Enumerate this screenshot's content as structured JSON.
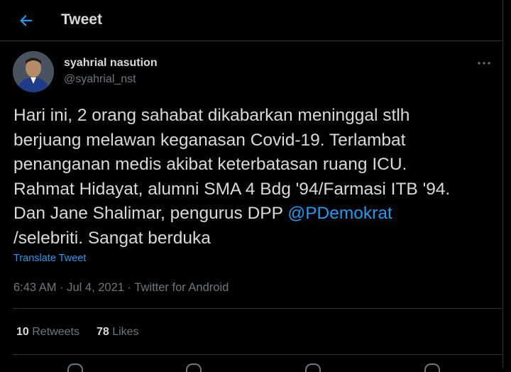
{
  "header": {
    "title": "Tweet"
  },
  "author": {
    "name": "syahrial nasution",
    "handle": "@syahrial_nst"
  },
  "tweet": {
    "lines": [
      "Hari ini, 2 orang sahabat dikabarkan meninggal stlh",
      "berjuang melawan keganasan Covid-19. Terlambat",
      "penanganan medis akibat keterbatasan ruang ICU.",
      "Rahmat Hidayat, alumni SMA 4 Bdg '94/Farmasi ITB '94.",
      "Dan Jane Shalimar, pengurus DPP ",
      "/selebriti. Sangat berduka"
    ],
    "mention": "@PDemokrat",
    "translate_label": "Translate Tweet"
  },
  "meta": {
    "time": "6:43 AM",
    "sep": " · ",
    "date": "Jul 4, 2021",
    "source": "Twitter for Android"
  },
  "stats": {
    "retweets_count": "10",
    "retweets_label": "Retweets",
    "likes_count": "78",
    "likes_label": "Likes"
  },
  "colors": {
    "background": "#000000",
    "text": "#d9d9d9",
    "muted": "#6e767d",
    "accent": "#1d9bf0",
    "border": "#2f3336"
  },
  "icons": [
    "back-arrow-icon",
    "more-icon"
  ]
}
